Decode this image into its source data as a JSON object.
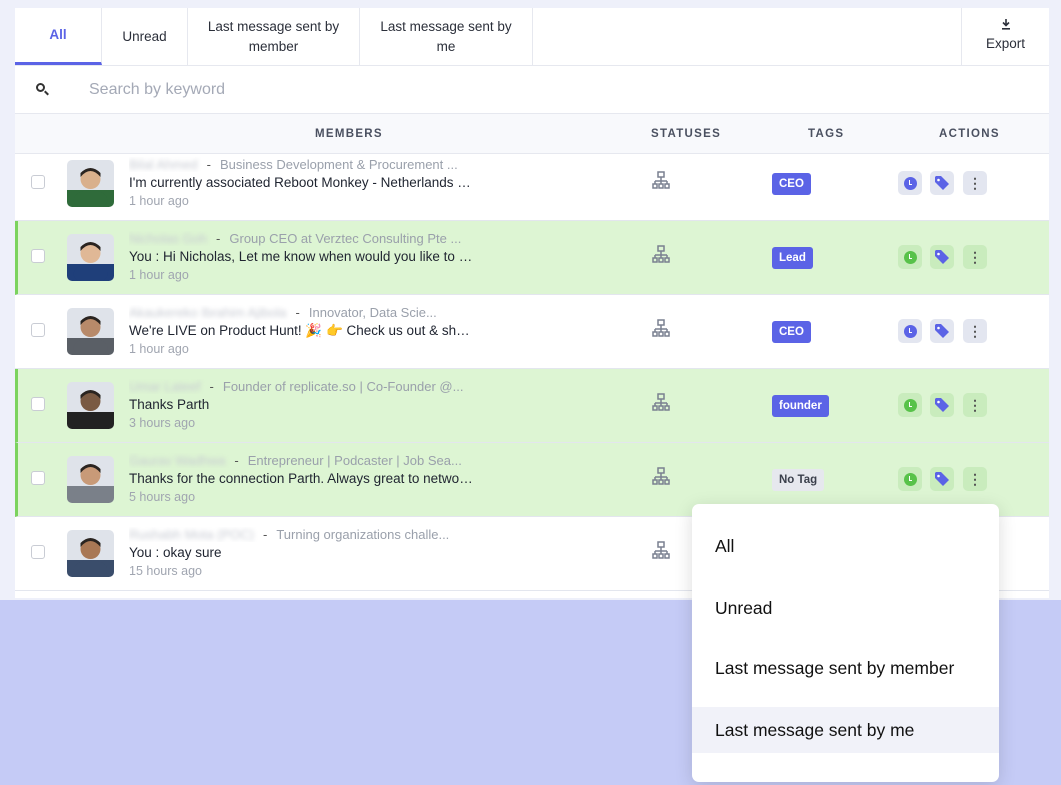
{
  "tabs": {
    "all": "All",
    "unread": "Unread",
    "member_l1": "Last message sent by",
    "member_l2": "member",
    "me_l1": "Last message sent by",
    "me_l2": "me",
    "export": "Export"
  },
  "search": {
    "placeholder": "Search by keyword"
  },
  "table_headers": {
    "members": "MEMBERS",
    "statuses": "STATUSES",
    "tags": "TAGS",
    "actions": "ACTIONS"
  },
  "rows": [
    {
      "name": "Bilal Ahmed",
      "headline": "Business Development & Procurement ...",
      "message": "I'm currently associated Reboot Monkey - Netherlands ba...",
      "time": "1 hour ago",
      "tag": "CEO",
      "highlighted": false,
      "status_color": "#5b63e6"
    },
    {
      "name": "Nicholas Goh",
      "headline": "Group CEO at Verztec Consulting Pte ...",
      "message": "You : Hi Nicholas, Let me know when would you like to try...",
      "time": "1 hour ago",
      "tag": "Lead",
      "highlighted": true,
      "status_color": "#58c24a"
    },
    {
      "name": "Akaukereko Ibrahim Ajibola",
      "headline": "Innovator, Data Scie...",
      "message": "We're LIVE on Product Hunt! 🎉 👉 Check us out & show ...",
      "time": "1 hour ago",
      "tag": "CEO",
      "highlighted": false,
      "status_color": "#5b63e6"
    },
    {
      "name": "Umar Lateef",
      "headline": "Founder of replicate.so | Co-Founder @...",
      "message": "Thanks Parth",
      "time": "3 hours ago",
      "tag": "founder",
      "highlighted": true,
      "status_color": "#58c24a"
    },
    {
      "name": "Gaurav Wadhwa",
      "headline": "Entrepreneur | Podcaster | Job Sea...",
      "message": "Thanks for the connection Parth. Always great to networ...",
      "time": "5 hours ago",
      "tag": "No Tag",
      "highlighted": true,
      "status_color": "#58c24a"
    },
    {
      "name": "Rushabh Mota (POC)",
      "headline": "Turning organizations challe...",
      "message": "You : okay sure",
      "time": "15 hours ago",
      "tag": "",
      "highlighted": false,
      "status_color": "#5b63e6"
    }
  ],
  "dropdown": {
    "items": [
      "All",
      "Unread",
      "Last message sent by member",
      "Last message sent by me"
    ],
    "selected": "Last message sent by me"
  },
  "colors": {
    "accent": "#5b63e6",
    "highlight_row": "#ddf5d3",
    "highlight_border": "#7bd35e",
    "background": "#c5cbf6"
  }
}
